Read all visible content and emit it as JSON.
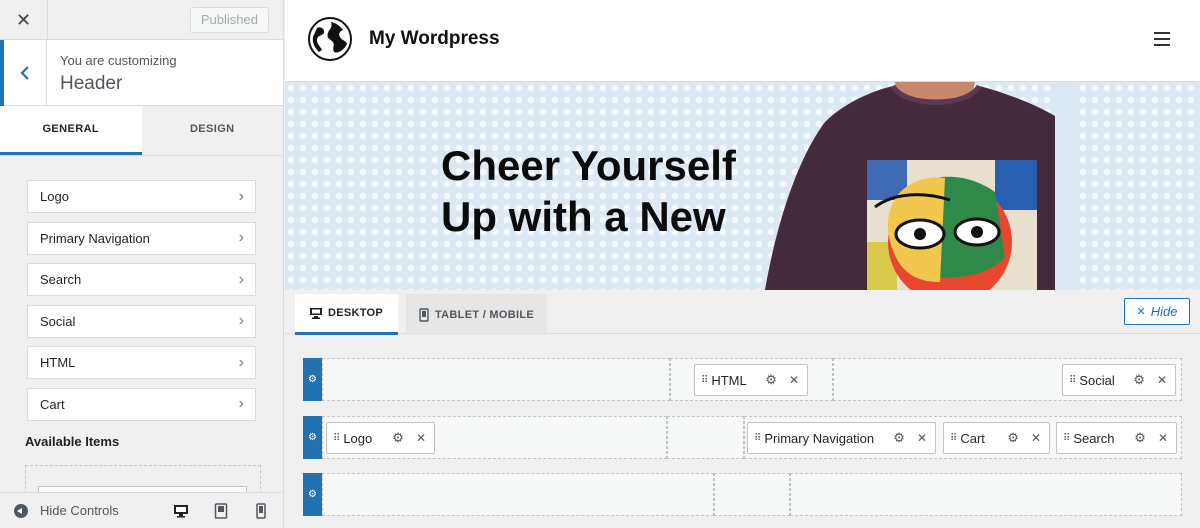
{
  "topbar": {
    "close_icon": "close-icon",
    "published_label": "Published"
  },
  "panel": {
    "customizing_label": "You are customizing",
    "section_title": "Header",
    "tabs": [
      {
        "label": "GENERAL",
        "active": true
      },
      {
        "label": "DESIGN",
        "active": false
      }
    ],
    "items": [
      {
        "label": "Logo"
      },
      {
        "label": "Primary Navigation"
      },
      {
        "label": "Search"
      },
      {
        "label": "Social"
      },
      {
        "label": "HTML"
      },
      {
        "label": "Cart"
      }
    ],
    "available_items_title": "Available Items"
  },
  "footer": {
    "hide_controls_label": "Hide Controls",
    "devices": [
      "desktop-icon",
      "tablet-icon",
      "mobile-icon"
    ]
  },
  "site": {
    "title": "My Wordpress",
    "hero_heading": "Cheer Yourself Up with a New"
  },
  "builder": {
    "tabs": [
      {
        "label": "DESKTOP",
        "active": true
      },
      {
        "label": "TABLET / MOBILE",
        "active": false
      }
    ],
    "hide_label": "Hide",
    "rows": {
      "top": [
        "HTML",
        "Social"
      ],
      "main": [
        "Logo",
        "Primary Navigation",
        "Cart",
        "Search"
      ],
      "bottom": []
    }
  },
  "colors": {
    "accent": "#2271b1",
    "hero_bg": "#dde8f5"
  }
}
